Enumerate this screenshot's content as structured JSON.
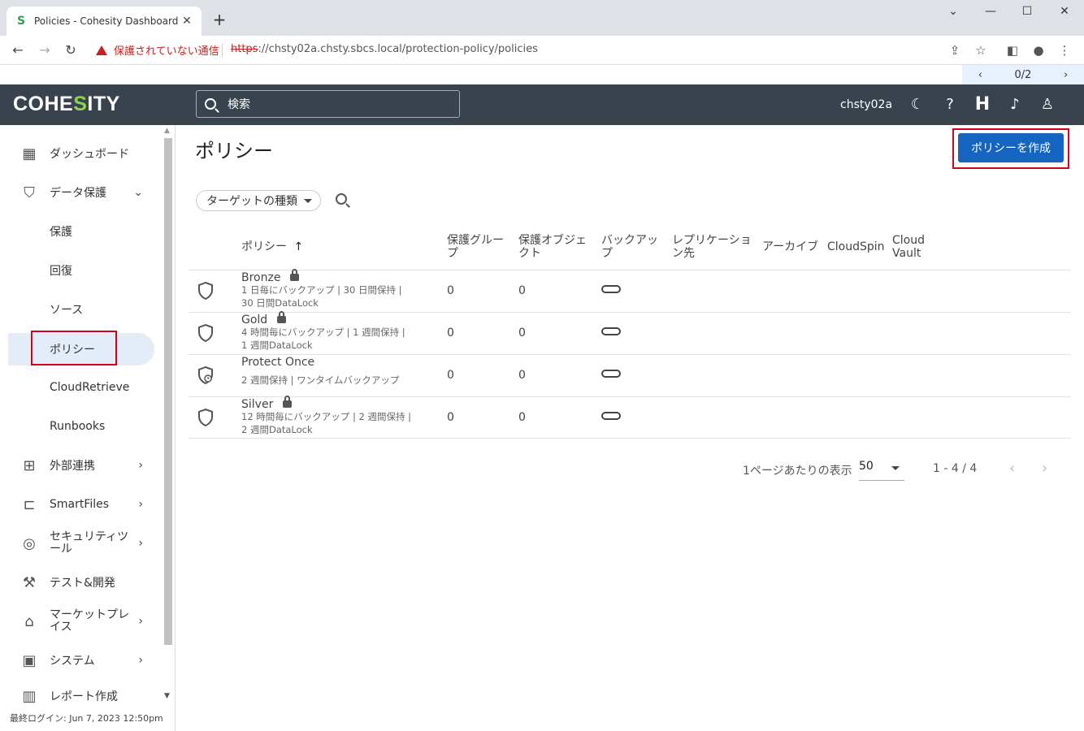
{
  "browser": {
    "tab_title": "Policies - Cohesity Dashboard",
    "tab_close": "✕",
    "new_tab": "+",
    "favicon": "S",
    "warning_text": "保護されていない通信",
    "url_scheme": "https",
    "url_rest": "://chsty02a.chsty.sbcs.local/protection-policy/policies",
    "find_count": "0/2"
  },
  "header": {
    "logo_pre": "COHE",
    "logo_mid": "S",
    "logo_post": "ITY",
    "search_placeholder": "検索",
    "cluster_name": "chsty02a",
    "health_letter": "H"
  },
  "sidebar": {
    "items": [
      {
        "label": "ダッシュボード",
        "icon": "dashboard-icon"
      },
      {
        "label": "データ保護",
        "icon": "shield-icon"
      },
      {
        "label": "保護"
      },
      {
        "label": "回復"
      },
      {
        "label": "ソース"
      },
      {
        "label": "ポリシー"
      },
      {
        "label": "CloudRetrieve"
      },
      {
        "label": "Runbooks"
      },
      {
        "label": "外部連携",
        "icon": "network-icon"
      },
      {
        "label": "SmartFiles",
        "icon": "folder-icon"
      },
      {
        "label_line1": "セキュリティツ",
        "label_line2": "ール",
        "icon": "fingerprint-icon"
      },
      {
        "label": "テスト&開発",
        "icon": "wrench-icon"
      },
      {
        "label_line1": "マーケットプレ",
        "label_line2": "イス",
        "icon": "store-icon"
      },
      {
        "label": "システム",
        "icon": "system-icon"
      },
      {
        "label": "レポート作成",
        "icon": "report-icon"
      }
    ],
    "last_login": "最終ログイン: Jun 7, 2023 12:50pm"
  },
  "main": {
    "title": "ポリシー",
    "create_button": "ポリシーを作成",
    "filter_label": "ターゲットの種類",
    "columns": {
      "policy": "ポリシー",
      "sort_arrow": "↑",
      "pg_line1": "保護グルー",
      "pg_line2": "プ",
      "po_line1": "保護オブジェ",
      "po_line2": "クト",
      "bk_line1": "バックアッ",
      "bk_line2": "プ",
      "rep_line1": "レプリケーショ",
      "rep_line2": "ン先",
      "archive": "アーカイブ",
      "cloudspin": "CloudSpin",
      "cv_line1": "Cloud",
      "cv_line2": "Vault"
    },
    "rows": [
      {
        "name": "Bronze",
        "desc1": "1 日毎にバックアップ | 30 日間保持 |",
        "desc2": "30 日間DataLock",
        "groups": "0",
        "objects": "0"
      },
      {
        "name": "Gold",
        "desc1": "4 時間毎にバックアップ | 1 週間保持 |",
        "desc2": "1 週間DataLock",
        "groups": "0",
        "objects": "0"
      },
      {
        "name": "Protect Once",
        "desc1": "2 週間保持 | ワンタイムバックアップ",
        "desc2": "",
        "groups": "0",
        "objects": "0"
      },
      {
        "name": "Silver",
        "desc1": "12 時間毎にバックアップ | 2 週間保持 |",
        "desc2": "2 週間DataLock",
        "groups": "0",
        "objects": "0"
      }
    ],
    "pager": {
      "per_page_label": "1ページあたりの表示",
      "per_page_value": "50",
      "range": "1 - 4 / 4"
    }
  }
}
